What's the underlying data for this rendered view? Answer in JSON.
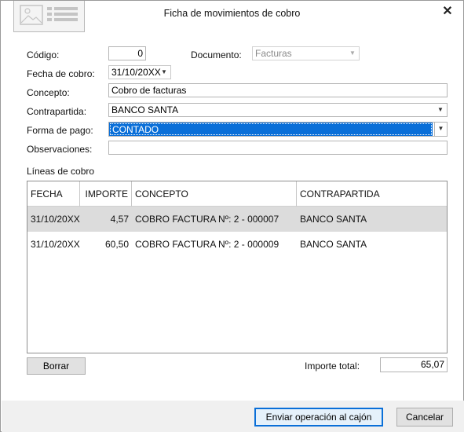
{
  "window": {
    "title": "Ficha de movimientos de cobro",
    "close_glyph": "✕"
  },
  "form": {
    "codigo_label": "Código:",
    "codigo_value": "0",
    "documento_label": "Documento:",
    "documento_value": "Facturas",
    "fecha_label": "Fecha de cobro:",
    "fecha_value": "31/10/20XX",
    "concepto_label": "Concepto:",
    "concepto_value": "Cobro de facturas",
    "contrapartida_label": "Contrapartida:",
    "contrapartida_value": "BANCO SANTA",
    "forma_pago_label": "Forma de pago:",
    "forma_pago_value": "CONTADO",
    "observaciones_label": "Observaciones:",
    "observaciones_value": ""
  },
  "lines": {
    "section_label": "Líneas de cobro",
    "columns": [
      "FECHA",
      "IMPORTE",
      "CONCEPTO",
      "CONTRAPARTIDA"
    ],
    "rows": [
      {
        "fecha": "31/10/20XX",
        "importe": "4,57",
        "concepto": "COBRO FACTURA Nº: 2 - 000007",
        "contrapartida": "BANCO SANTA"
      },
      {
        "fecha": "31/10/20XX",
        "importe": "60,50",
        "concepto": "COBRO FACTURA Nº: 2 - 000009",
        "contrapartida": "BANCO SANTA"
      }
    ]
  },
  "bottom": {
    "borrar_label": "Borrar",
    "importe_total_label": "Importe total:",
    "importe_total_value": "65,07"
  },
  "footer": {
    "enviar_label": "Enviar operación al cajón",
    "cancelar_label": "Cancelar"
  },
  "colors": {
    "accent": "#0a6fd8",
    "selected_row": "#dcdcdc"
  },
  "icons": {
    "logo": "document-card-icon",
    "close": "close-icon",
    "dropdown": "chevron-down-icon"
  }
}
